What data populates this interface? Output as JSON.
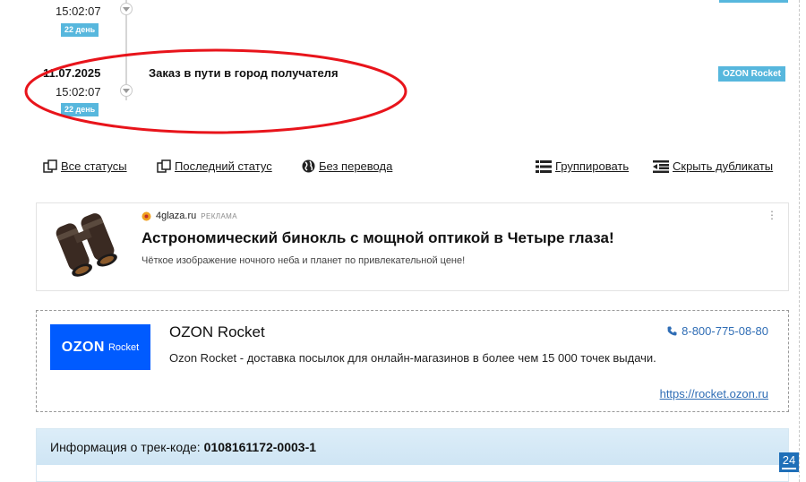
{
  "timeline": {
    "prev_event": {
      "time": "15:02:07",
      "day_badge": "22 день"
    },
    "event": {
      "date": "11.07.2025",
      "time": "15:02:07",
      "day_badge": "22 день",
      "status": "Заказ в пути в город получателя",
      "carrier_tag": "OZON Rocket"
    }
  },
  "toolbar": {
    "all_statuses": "Все статусы",
    "last_status": "Последний статус",
    "no_translation": "Без перевода",
    "group": "Группировать",
    "hide_duplicates": "Скрыть дубликаты"
  },
  "ad": {
    "source": "4glaza.ru",
    "mark": "РЕКЛАМА",
    "title": "Астрономический бинокль с мощной оптикой в Четыре глаза!",
    "description": "Чёткое изображение ночного неба и планет по привлекательной цене!",
    "menu": "⋮"
  },
  "carrier": {
    "logo_word1": "OZON",
    "logo_word2": "Rocket",
    "name": "OZON Rocket",
    "phone": "8-800-775-08-80",
    "description": "Ozon Rocket - доставка посылок для онлайн-магазинов в более чем 15 000 точек выдачи.",
    "website": "https://rocket.ozon.ru"
  },
  "info": {
    "label": "Информация о трек-коде:",
    "track_code": "0108161172-0003-1"
  },
  "page_number": "24",
  "colors": {
    "badge": "#57b7dd",
    "highlight_ellipse": "#e8141b",
    "link": "#2f6db5",
    "ozon_blue": "#005bff"
  }
}
